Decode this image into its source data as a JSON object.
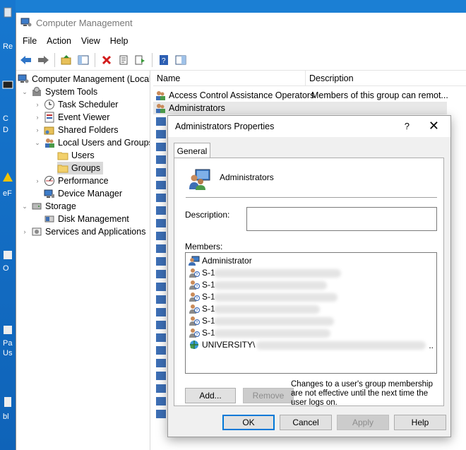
{
  "desktop": {
    "labels": [
      "Re",
      "C",
      "D",
      "eF",
      "O",
      "Pa",
      "Us",
      "bl"
    ]
  },
  "window": {
    "title": "Computer Management",
    "menu": [
      "File",
      "Action",
      "View",
      "Help"
    ]
  },
  "tree": {
    "root": "Computer Management (Local",
    "system_tools": "System Tools",
    "task_scheduler": "Task Scheduler",
    "event_viewer": "Event Viewer",
    "shared_folders": "Shared Folders",
    "local_users_groups": "Local Users and Groups",
    "users": "Users",
    "groups": "Groups",
    "performance": "Performance",
    "device_manager": "Device Manager",
    "storage": "Storage",
    "disk_management": "Disk Management",
    "services_apps": "Services and Applications"
  },
  "list": {
    "col_name": "Name",
    "col_description": "Description",
    "rows": [
      {
        "name": "Access Control Assistance Operators",
        "description": "Members of this group can remot..."
      },
      {
        "name": "Administrators",
        "description": ""
      }
    ]
  },
  "dialog": {
    "title": "Administrators Properties",
    "help": "?",
    "close": "✕",
    "tab_general": "General",
    "group_name": "Administrators",
    "description_label": "Description:",
    "description_value": "",
    "members_label": "Members:",
    "members": [
      {
        "name": "Administrator",
        "icon": "user-icon"
      },
      {
        "name": "S-1",
        "icon": "unknown-account-icon"
      },
      {
        "name": "S-1",
        "icon": "unknown-account-icon"
      },
      {
        "name": "S-1",
        "icon": "unknown-account-icon"
      },
      {
        "name": "S-1",
        "icon": "unknown-account-icon"
      },
      {
        "name": "S-1",
        "icon": "unknown-account-icon"
      },
      {
        "name": "S-1",
        "icon": "unknown-account-icon"
      },
      {
        "name": "UNIVERSITY\\",
        "icon": "domain-group-icon"
      }
    ],
    "member_ellipsis": "..",
    "add_button": "Add...",
    "remove_button": "Remove",
    "note": "Changes to a user's group membership are not effective until the next time the user logs on.",
    "ok_button": "OK",
    "cancel_button": "Cancel",
    "apply_button": "Apply",
    "help_button": "Help"
  },
  "colors": {
    "desktop": "#1b7fd4",
    "selection": "#d9d9d9",
    "default_button_border": "#0078d7"
  }
}
